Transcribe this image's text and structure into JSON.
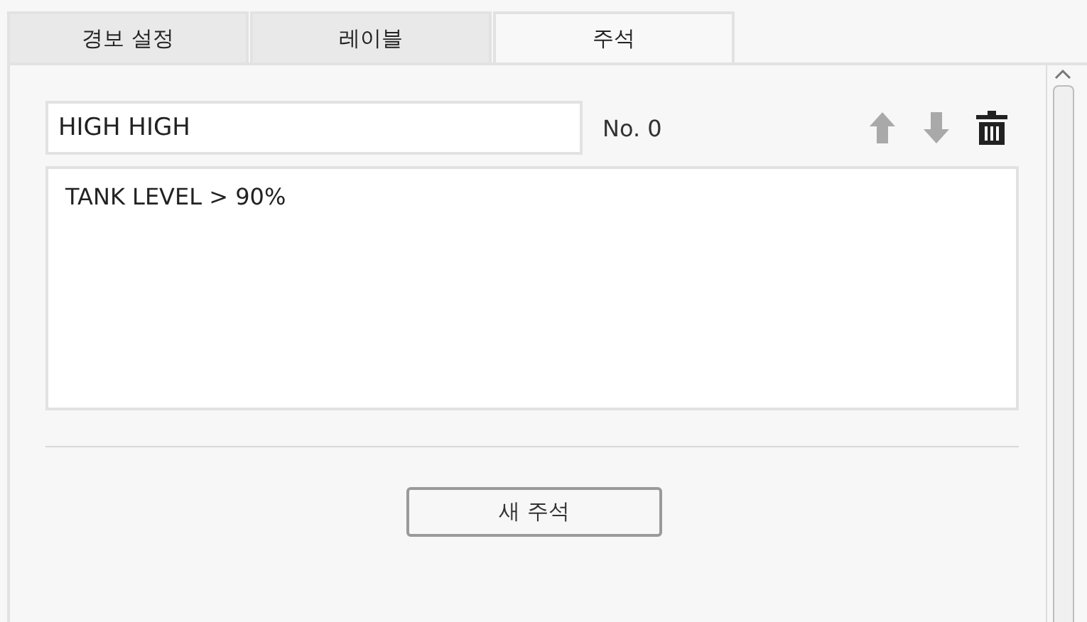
{
  "tabs": [
    {
      "label": "경보 설정",
      "selected": false
    },
    {
      "label": "레이블",
      "selected": false
    },
    {
      "label": "주석",
      "selected": true
    }
  ],
  "annotation": {
    "name": {
      "value": "HIGH HIGH"
    },
    "number": "No. 0",
    "text": {
      "value": "TANK LEVEL > 90%"
    },
    "tools": [
      {
        "kind": "up",
        "disabled": true
      },
      {
        "kind": "down",
        "disabled": true
      },
      {
        "kind": "delete",
        "disabled": false
      }
    ]
  },
  "new_button": {
    "label": "새 주석"
  }
}
